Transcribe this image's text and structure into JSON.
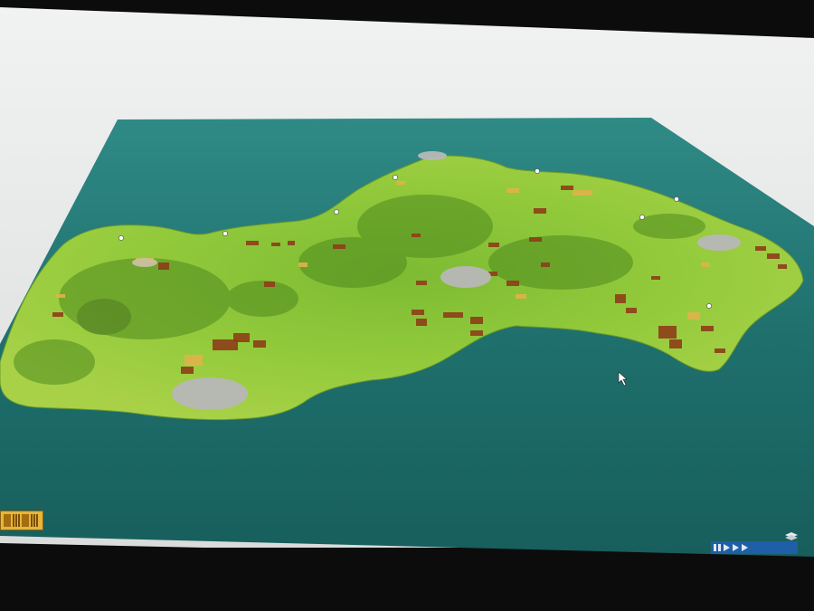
{
  "window": {
    "title": ""
  },
  "map": {
    "water_color": "#1e6f6e",
    "land_color": "#8fc83a",
    "highland_color": "#4f8a1e",
    "field_color": "#8e3d18",
    "field_alt_color": "#e0b24a",
    "town_color": "#b8b8b8",
    "town_labels": [
      "",
      "",
      "",
      "",
      ""
    ]
  },
  "toolbar_left": {
    "icons": [
      "building-icon",
      "bar-chart-icon",
      "industry-icon",
      "stats-icon"
    ]
  },
  "toolbar_right": {
    "icons": [
      "pause-icon",
      "play-icon",
      "fast-forward-icon",
      "fastest-icon"
    ],
    "clock": ""
  }
}
